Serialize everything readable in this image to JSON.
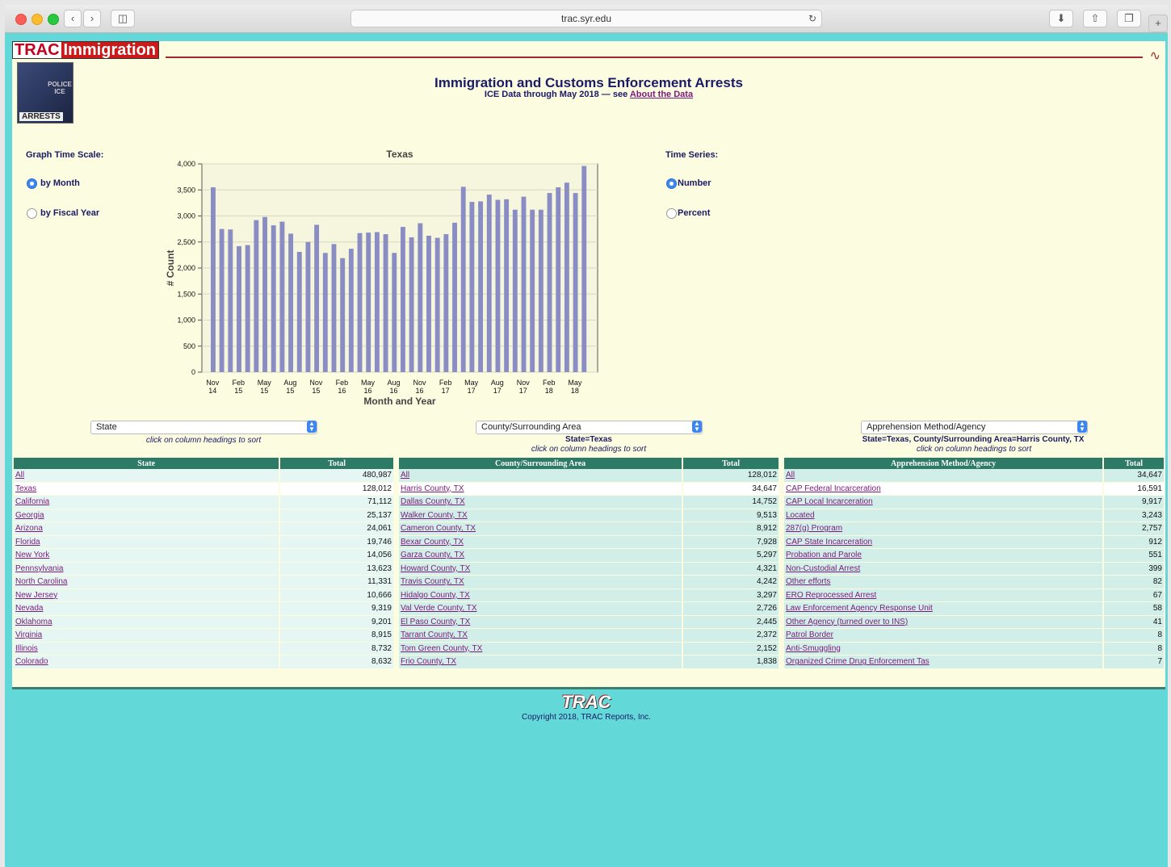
{
  "browser": {
    "url": "trac.syr.edu"
  },
  "header": {
    "logo_trac": "TRAC",
    "logo_imm": "Immigration",
    "photo_label": "ARRESTS",
    "photo_ice": "POLICE ICE",
    "title": "Immigration and Customs Enforcement Arrests",
    "subtitle_prefix": "ICE Data through May 2018 — see ",
    "subtitle_link": "About the Data"
  },
  "controls": {
    "time_scale_label": "Graph Time Scale:",
    "by_month": "by Month",
    "by_fiscal_year": "by Fiscal Year",
    "time_series_label": "Time Series:",
    "number": "Number",
    "percent": "Percent"
  },
  "chart_data": {
    "type": "bar",
    "title": "Texas",
    "xlabel": "Month and Year",
    "ylabel": "# Count",
    "ylim": [
      0,
      4000
    ],
    "yticks": [
      "0",
      "500",
      "1,000",
      "1,500",
      "2,000",
      "2,500",
      "3,000",
      "3,500",
      "4,000"
    ],
    "xtick_labels": [
      [
        "Nov",
        "14"
      ],
      [
        "Feb",
        "15"
      ],
      [
        "May",
        "15"
      ],
      [
        "Aug",
        "15"
      ],
      [
        "Nov",
        "15"
      ],
      [
        "Feb",
        "16"
      ],
      [
        "May",
        "16"
      ],
      [
        "Aug",
        "16"
      ],
      [
        "Nov",
        "16"
      ],
      [
        "Feb",
        "17"
      ],
      [
        "May",
        "17"
      ],
      [
        "Aug",
        "17"
      ],
      [
        "Nov",
        "17"
      ],
      [
        "Feb",
        "18"
      ],
      [
        "May",
        "18"
      ]
    ],
    "values": [
      3550,
      2750,
      2740,
      2420,
      2440,
      2920,
      2980,
      2820,
      2890,
      2660,
      2310,
      2500,
      2830,
      2290,
      2460,
      2190,
      2370,
      2670,
      2680,
      2690,
      2650,
      2290,
      2790,
      2590,
      2860,
      2620,
      2580,
      2650,
      2870,
      3560,
      3270,
      3280,
      3410,
      3310,
      3320,
      3120,
      3370,
      3120,
      3120,
      3440,
      3550,
      3640,
      3440,
      3960
    ]
  },
  "panels": [
    {
      "select_value": "State",
      "filter_text": "",
      "hint": "click on column headings to sort",
      "col_name": "State",
      "col_total": "Total",
      "rows": [
        [
          "All",
          "480,987"
        ],
        [
          "Texas",
          "128,012"
        ],
        [
          "California",
          "71,112"
        ],
        [
          "Georgia",
          "25,137"
        ],
        [
          "Arizona",
          "24,061"
        ],
        [
          "Florida",
          "19,746"
        ],
        [
          "New York",
          "14,056"
        ],
        [
          "Pennsylvania",
          "13,623"
        ],
        [
          "North Carolina",
          "11,331"
        ],
        [
          "New Jersey",
          "10,666"
        ],
        [
          "Nevada",
          "9,319"
        ],
        [
          "Oklahoma",
          "9,201"
        ],
        [
          "Virginia",
          "8,915"
        ],
        [
          "Illinois",
          "8,732"
        ],
        [
          "Colorado",
          "8,632"
        ]
      ]
    },
    {
      "select_value": "County/Surrounding Area",
      "filter_text": "State=Texas",
      "hint": "click on column headings to sort",
      "col_name": "County/Surrounding Area",
      "col_total": "Total",
      "rows": [
        [
          "All",
          "128,012"
        ],
        [
          "Harris County, TX",
          "34,647"
        ],
        [
          "Dallas County, TX",
          "14,752"
        ],
        [
          "Walker County, TX",
          "9,513"
        ],
        [
          "Cameron County, TX",
          "8,912"
        ],
        [
          "Bexar County, TX",
          "7,928"
        ],
        [
          "Garza County, TX",
          "5,297"
        ],
        [
          "Howard County, TX",
          "4,321"
        ],
        [
          "Travis County, TX",
          "4,242"
        ],
        [
          "Hidalgo County, TX",
          "3,297"
        ],
        [
          "Val Verde County, TX",
          "2,726"
        ],
        [
          "El Paso County, TX",
          "2,445"
        ],
        [
          "Tarrant County, TX",
          "2,372"
        ],
        [
          "Tom Green County, TX",
          "2,152"
        ],
        [
          "Frio County, TX",
          "1,838"
        ]
      ]
    },
    {
      "select_value": "Apprehension Method/Agency",
      "filter_text": "State=Texas, County/Surrounding Area=Harris County, TX",
      "hint": "click on column headings to sort",
      "col_name": "Apprehension Method/Agency",
      "col_total": "Total",
      "rows": [
        [
          "All",
          "34,647"
        ],
        [
          "CAP Federal Incarceration",
          "16,591"
        ],
        [
          "CAP Local Incarceration",
          "9,917"
        ],
        [
          "Located",
          "3,243"
        ],
        [
          "287(g) Program",
          "2,757"
        ],
        [
          "CAP State Incarceration",
          "912"
        ],
        [
          "Probation and Parole",
          "551"
        ],
        [
          "Non-Custodial Arrest",
          "399"
        ],
        [
          "Other efforts",
          "82"
        ],
        [
          "ERO Reprocessed Arrest",
          "67"
        ],
        [
          "Law Enforcement Agency Response Unit",
          "58"
        ],
        [
          "Other Agency (turned over to INS)",
          "41"
        ],
        [
          "Patrol Border",
          "8"
        ],
        [
          "Anti-Smuggling",
          "8"
        ],
        [
          "Organized Crime Drug Enforcement Tas",
          "7"
        ]
      ]
    }
  ],
  "footer": {
    "logo": "TRAC",
    "copyright": "Copyright 2018, TRAC Reports, Inc."
  }
}
